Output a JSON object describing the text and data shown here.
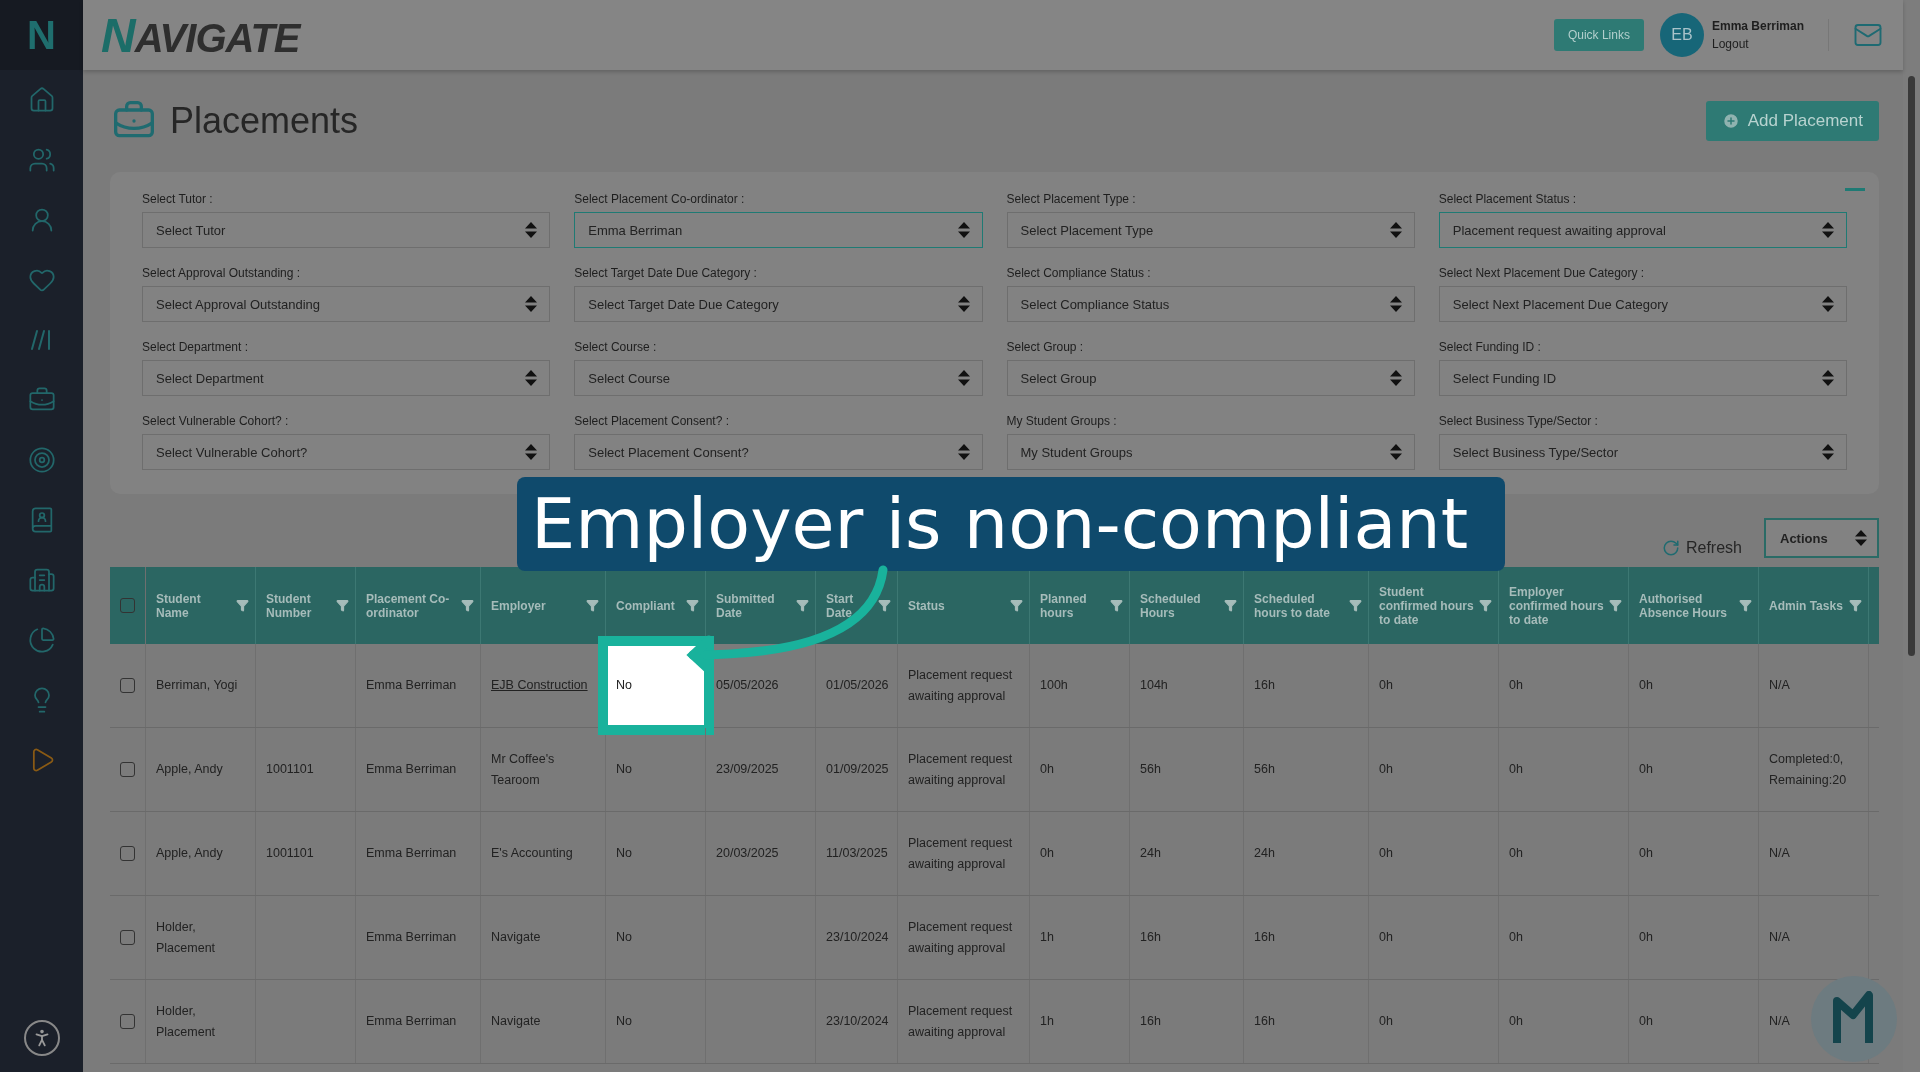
{
  "sidebar": {
    "logo": "N"
  },
  "header": {
    "logo": "NAVIGATE",
    "quick_links": "Quick Links",
    "user": {
      "initials": "EB",
      "name": "Emma Berriman",
      "logout": "Logout"
    }
  },
  "page": {
    "title": "Placements",
    "add_button": "Add Placement"
  },
  "filters": [
    {
      "label": "Select Tutor :",
      "value": "Select Tutor",
      "active": false
    },
    {
      "label": "Select Placement Co-ordinator :",
      "value": "Emma Berriman",
      "active": true
    },
    {
      "label": "Select Placement Type :",
      "value": "Select Placement Type",
      "active": false
    },
    {
      "label": "Select Placement Status :",
      "value": "Placement request awaiting approval",
      "active": true
    },
    {
      "label": "Select Approval Outstanding :",
      "value": "Select Approval Outstanding",
      "active": false
    },
    {
      "label": "Select Target Date Due Category :",
      "value": "Select Target Date Due Category",
      "active": false
    },
    {
      "label": "Select Compliance Status :",
      "value": "Select Compliance Status",
      "active": false
    },
    {
      "label": "Select Next Placement Due Category :",
      "value": "Select Next Placement Due Category",
      "active": false
    },
    {
      "label": "Select Department :",
      "value": "Select Department",
      "active": false
    },
    {
      "label": "Select Course :",
      "value": "Select Course",
      "active": false
    },
    {
      "label": "Select Group :",
      "value": "Select Group",
      "active": false
    },
    {
      "label": "Select Funding ID :",
      "value": "Select Funding ID",
      "active": false
    },
    {
      "label": "Select Vulnerable Cohort? :",
      "value": "Select Vulnerable Cohort?",
      "active": false
    },
    {
      "label": "Select Placement Consent? :",
      "value": "Select Placement Consent?",
      "active": false
    },
    {
      "label": "My Student Groups :",
      "value": "My Student Groups",
      "active": false
    },
    {
      "label": "Select Business Type/Sector :",
      "value": "Select Business Type/Sector",
      "active": false
    }
  ],
  "toolbar": {
    "refresh": "Refresh",
    "actions": "Actions"
  },
  "table": {
    "select_all_checked": false,
    "columns": [
      "Student Name",
      "Student Number",
      "Placement Co-ordinator",
      "Employer",
      "Compliant",
      "Submitted Date",
      "Start Date",
      "Status",
      "Planned hours",
      "Scheduled Hours",
      "Scheduled hours to date",
      "Student confirmed hours to date",
      "Employer confirmed hours to date",
      "Authorised Absence Hours",
      "Admin Tasks"
    ],
    "rows": [
      {
        "checked": false,
        "employer_link": true,
        "compliant_highlighted": true,
        "cells": [
          "Berriman, Yogi",
          "",
          "Emma Berriman",
          "EJB Construction",
          "No",
          "05/05/2026",
          "01/05/2026",
          "Placement request awaiting approval",
          "100h",
          "104h",
          "16h",
          "0h",
          "0h",
          "0h",
          "N/A"
        ]
      },
      {
        "checked": false,
        "employer_link": false,
        "compliant_highlighted": false,
        "cells": [
          "Apple, Andy",
          "1001101",
          "Emma Berriman",
          "Mr Coffee's Tearoom",
          "No",
          "23/09/2025",
          "01/09/2025",
          "Placement request awaiting approval",
          "0h",
          "56h",
          "56h",
          "0h",
          "0h",
          "0h",
          "Completed:0, Remaining:20"
        ]
      },
      {
        "checked": false,
        "employer_link": false,
        "compliant_highlighted": false,
        "cells": [
          "Apple, Andy",
          "1001101",
          "Emma Berriman",
          "E's Accounting",
          "No",
          "20/03/2025",
          "11/03/2025",
          "Placement request awaiting approval",
          "0h",
          "24h",
          "24h",
          "0h",
          "0h",
          "0h",
          "N/A"
        ]
      },
      {
        "checked": false,
        "employer_link": false,
        "compliant_highlighted": false,
        "cells": [
          "Holder, Placement",
          "",
          "Emma Berriman",
          "Navigate",
          "No",
          "",
          "23/10/2024",
          "Placement request awaiting approval",
          "1h",
          "16h",
          "16h",
          "0h",
          "0h",
          "0h",
          "N/A"
        ]
      },
      {
        "checked": false,
        "employer_link": false,
        "compliant_highlighted": false,
        "cells": [
          "Holder, Placement",
          "",
          "Emma Berriman",
          "Navigate",
          "No",
          "",
          "23/10/2024",
          "Placement request awaiting approval",
          "1h",
          "16h",
          "16h",
          "0h",
          "0h",
          "0h",
          "N/A"
        ]
      }
    ]
  },
  "callout": {
    "text": "Employer is non-compliant"
  }
}
